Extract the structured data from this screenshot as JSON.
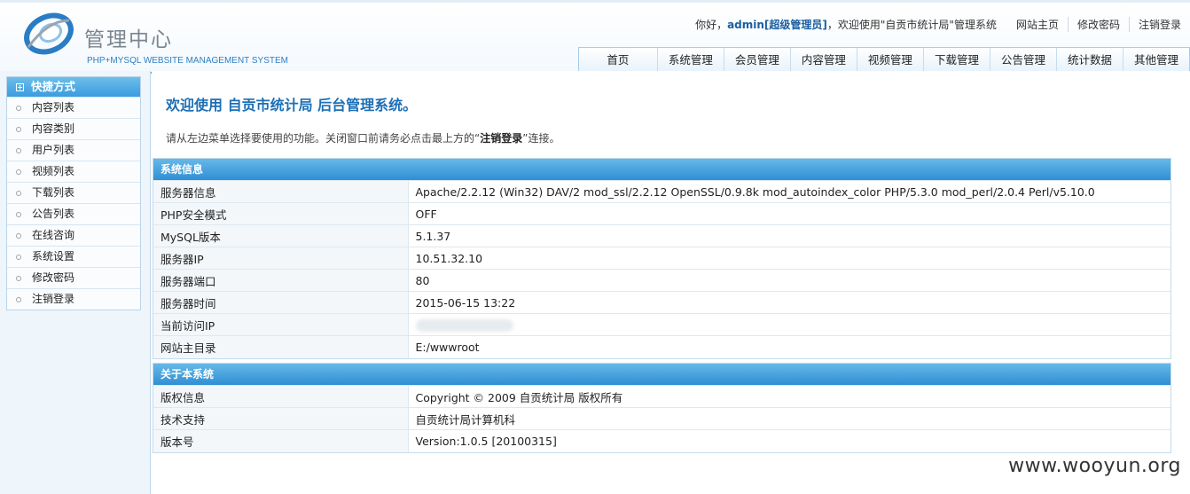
{
  "header": {
    "logo_text": "管理中心",
    "logo_sub": "PHP+MYSQL WEBSITE MANAGEMENT SYSTEM",
    "greet_prefix": "你好，",
    "username": "admin[超级管理员]",
    "greet_suffix": "，欢迎使用\"自贡市统计局\"管理系统",
    "links": [
      "网站主页",
      "修改密码",
      "注销登录"
    ],
    "nav_tabs": [
      "首页",
      "系统管理",
      "会员管理",
      "内容管理",
      "视频管理",
      "下载管理",
      "公告管理",
      "统计数据",
      "其他管理"
    ]
  },
  "sidebar": {
    "title": "快捷方式",
    "items": [
      "内容列表",
      "内容类别",
      "用户列表",
      "视频列表",
      "下载列表",
      "公告列表",
      "在线咨询",
      "系统设置",
      "修改密码",
      "注销登录"
    ]
  },
  "main": {
    "welcome": "欢迎使用 自贡市统计局 后台管理系统。",
    "tip_prefix": "请从左边菜单选择要使用的功能。关闭窗口前请务必点击最上方的“",
    "tip_bold": "注销登录",
    "tip_suffix": "”连接。",
    "system_info": {
      "title": "系统信息",
      "rows": [
        {
          "key": "服务器信息",
          "value": "Apache/2.2.12 (Win32) DAV/2 mod_ssl/2.2.12 OpenSSL/0.9.8k mod_autoindex_color PHP/5.3.0 mod_perl/2.0.4 Perl/v5.10.0"
        },
        {
          "key": "PHP安全模式",
          "value": "OFF"
        },
        {
          "key": "MySQL版本",
          "value": "5.1.37"
        },
        {
          "key": "服务器IP",
          "value": "10.51.32.10"
        },
        {
          "key": "服务器端口",
          "value": "80"
        },
        {
          "key": "服务器时间",
          "value": "2015-06-15 13:22"
        },
        {
          "key": "当前访问IP",
          "value": ""
        },
        {
          "key": "网站主目录",
          "value": "E:/wwwroot"
        }
      ]
    },
    "about": {
      "title": "关于本系统",
      "rows": [
        {
          "key": "版权信息",
          "value": "Copyright © 2009 自贡统计局 版权所有"
        },
        {
          "key": "技术支持",
          "value": "自贡统计局计算机科"
        },
        {
          "key": "版本号",
          "value": "Version:1.0.5 [20100315]"
        }
      ]
    }
  },
  "watermark": "www.wooyun.org"
}
